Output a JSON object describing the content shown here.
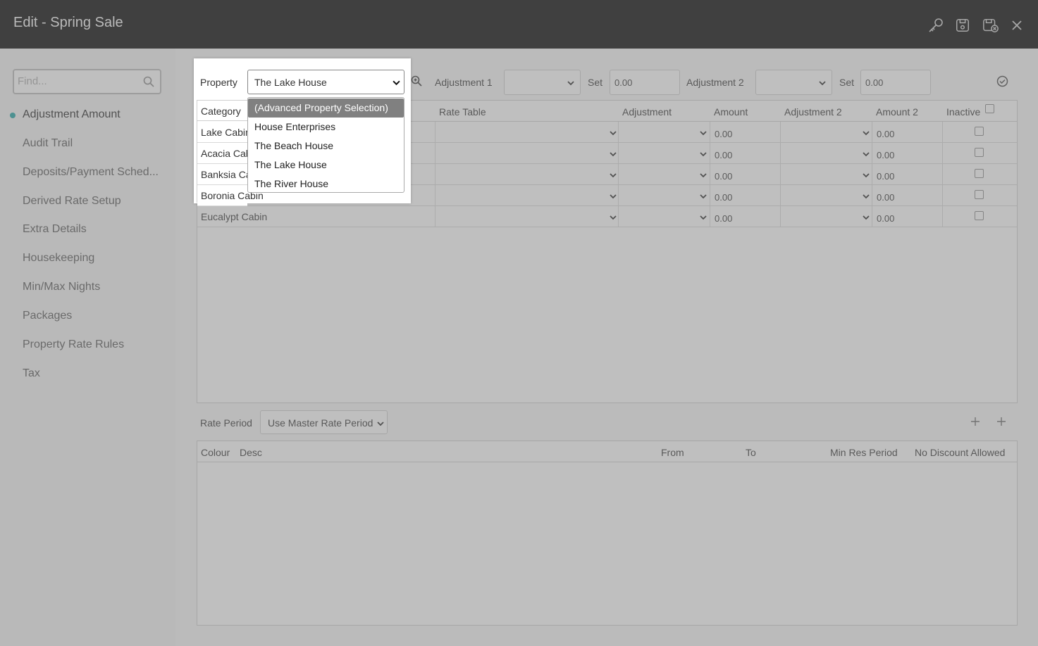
{
  "window": {
    "title": "Edit - Spring Sale"
  },
  "toolbar_icons": [
    "key-icon",
    "save-icon",
    "save-close-icon",
    "close-icon"
  ],
  "sidebar": {
    "search_placeholder": "Find...",
    "items": [
      {
        "label": "Adjustment Amount",
        "active": true
      },
      {
        "label": "Audit Trail"
      },
      {
        "label": "Deposits/Payment Sched..."
      },
      {
        "label": "Derived Rate Setup"
      },
      {
        "label": "Extra Details"
      },
      {
        "label": "Housekeeping"
      },
      {
        "label": "Min/Max Nights"
      },
      {
        "label": "Packages"
      },
      {
        "label": "Property Rate Rules"
      },
      {
        "label": "Tax"
      }
    ]
  },
  "filters": {
    "property_label": "Property",
    "property_value": "The Lake House",
    "adjustment1_label": "Adjustment 1",
    "adjustment1_value": "",
    "set1_label": "Set",
    "set1_value": "0.00",
    "adjustment2_label": "Adjustment 2",
    "adjustment2_value": "",
    "set2_label": "Set",
    "set2_value": "0.00"
  },
  "property_dropdown": {
    "options": [
      "(Advanced Property Selection)",
      "House Enterprises",
      "The Beach House",
      "The Lake House",
      "The River House"
    ],
    "highlighted": "(Advanced Property Selection)"
  },
  "category_grid": {
    "headers": [
      "Category",
      "Rate Table",
      "Adjustment",
      "Amount",
      "Adjustment 2",
      "Amount 2",
      "Inactive"
    ],
    "rows": [
      {
        "category": "Lake Cabin",
        "amount": "0.00",
        "amount2": "0.00"
      },
      {
        "category": "Acacia Cabin",
        "amount": "0.00",
        "amount2": "0.00"
      },
      {
        "category": "Banksia Cabin",
        "amount": "0.00",
        "amount2": "0.00"
      },
      {
        "category": "Boronia Cabin",
        "amount": "0.00",
        "amount2": "0.00"
      },
      {
        "category": "Eucalypt Cabin",
        "amount": "0.00",
        "amount2": "0.00"
      }
    ]
  },
  "rate_period": {
    "label": "Rate Period",
    "value": "Use Master Rate Period"
  },
  "period_grid": {
    "headers": [
      "Colour",
      "Desc",
      "From",
      "To",
      "Min Res Period",
      "No Discount Allowed"
    ]
  }
}
